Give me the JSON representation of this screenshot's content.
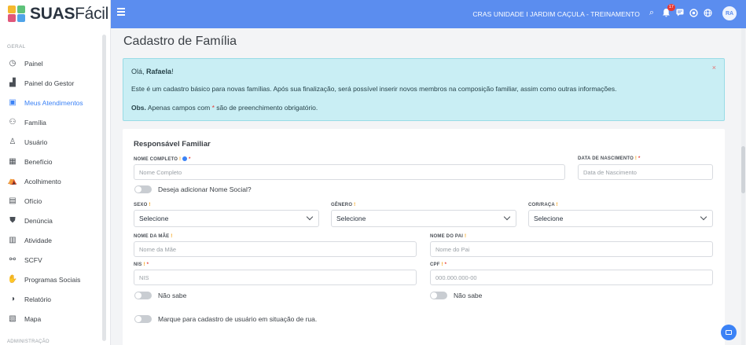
{
  "app": {
    "logo_bold": "SUAS",
    "logo_light": "Fácil"
  },
  "sidebar": {
    "section_general": "GERAL",
    "section_admin": "ADMINISTRAÇÃO",
    "items": [
      {
        "label": "Painel",
        "icon": "dashboard-icon",
        "glyph": "◷"
      },
      {
        "label": "Painel do Gestor",
        "icon": "chart-icon",
        "glyph": "▟"
      },
      {
        "label": "Meus Atendimentos",
        "icon": "id-card-icon",
        "glyph": "▣",
        "active": true
      },
      {
        "label": "Família",
        "icon": "family-icon",
        "glyph": "⚇"
      },
      {
        "label": "Usuário",
        "icon": "user-icon",
        "glyph": "♙"
      },
      {
        "label": "Benefício",
        "icon": "benefit-icon",
        "glyph": "▦"
      },
      {
        "label": "Acolhimento",
        "icon": "shelter-icon",
        "glyph": "⛺"
      },
      {
        "label": "Ofício",
        "icon": "document-icon",
        "glyph": "▤"
      },
      {
        "label": "Denúncia",
        "icon": "shield-icon",
        "glyph": "⛊"
      },
      {
        "label": "Atividade",
        "icon": "activity-icon",
        "glyph": "▥"
      },
      {
        "label": "SCFV",
        "icon": "network-icon",
        "glyph": "⚯"
      },
      {
        "label": "Programas Sociais",
        "icon": "handshake-icon",
        "glyph": "✋"
      },
      {
        "label": "Relatório",
        "icon": "pie-chart-icon",
        "glyph": "◑"
      },
      {
        "label": "Mapa",
        "icon": "map-icon",
        "glyph": "▧"
      }
    ]
  },
  "header": {
    "unit": "CRAS UNIDADE I JARDIM CAÇULA - TREINAMENTO",
    "notifications": "17",
    "avatar": "RA"
  },
  "page": {
    "title": "Cadastro de Família"
  },
  "alert": {
    "greeting": "Olá,",
    "name": "Rafaela",
    "greeting_end": "!",
    "message": "Este é um cadastro básico para novas famílias. Após sua finalização, será possível inserir novos membros na composição familiar, assim como outras informações.",
    "obs_label": "Obs.",
    "obs_text": "Apenas campos com",
    "obs_star": "*",
    "obs_end": "são de preenchimento obrigatório.",
    "close": "×"
  },
  "form": {
    "section_title": "Responsável Familiar",
    "fields": {
      "nome_completo": {
        "label": "NOME COMPLETO",
        "placeholder": "Nome Completo"
      },
      "data_nascimento": {
        "label": "DATA DE NASCIMENTO",
        "placeholder": "Data de Nascimento"
      },
      "nome_social": {
        "label": "Deseja adicionar Nome Social?"
      },
      "sexo": {
        "label": "SEXO",
        "value": "Selecione"
      },
      "genero": {
        "label": "GÊNERO",
        "value": "Selecione"
      },
      "cor_raca": {
        "label": "COR/RAÇA",
        "value": "Selecione"
      },
      "nome_mae": {
        "label": "NOME DA MÃE",
        "placeholder": "Nome da Mãe"
      },
      "nome_pai": {
        "label": "NOME DO PAI",
        "placeholder": "Nome do Pai"
      },
      "nis": {
        "label": "NIS",
        "placeholder": "NIS",
        "nao_sabe": "Não sabe"
      },
      "cpf": {
        "label": "CPF",
        "placeholder": "000.000.000-00",
        "nao_sabe": "Não sabe"
      },
      "situacao_rua": {
        "label": "Marque para cadastro de usuário em situação de rua."
      }
    },
    "required_mark": "!",
    "star": "*"
  },
  "colors": {
    "header": "#5b8def",
    "active": "#3b82f6",
    "alert_bg": "#c9eef4"
  }
}
